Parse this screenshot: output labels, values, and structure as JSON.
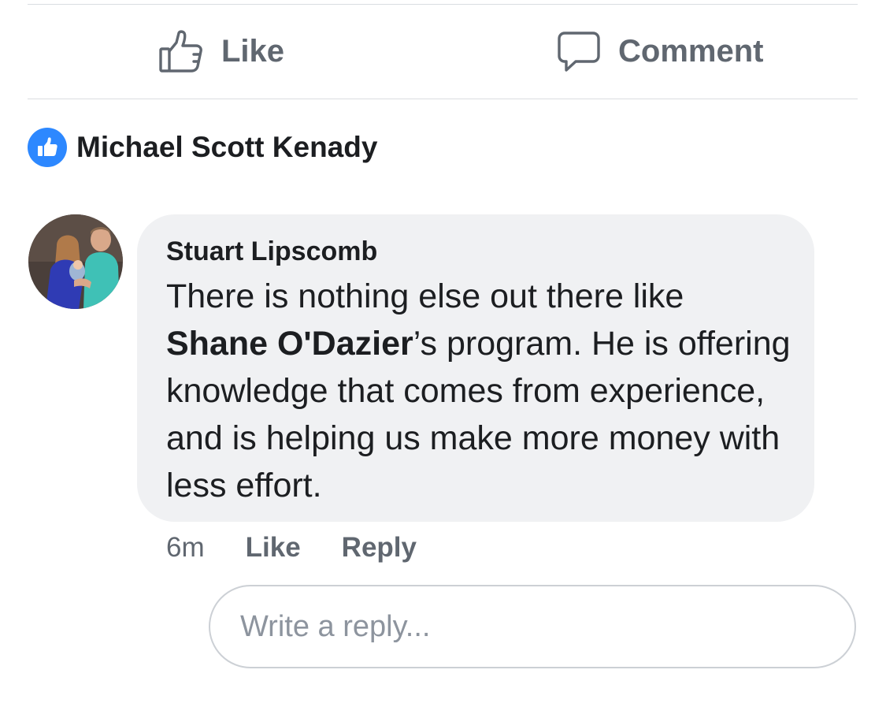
{
  "actions": {
    "like_label": "Like",
    "comment_label": "Comment"
  },
  "reactions": {
    "icon": "thumbs-up-badge-icon",
    "reactor_name": "Michael Scott Kenady"
  },
  "comment": {
    "author": "Stuart Lipscomb",
    "text_before": "There is nothing else out there like ",
    "mention": "Shane O'Dazier",
    "text_after": "’s program. He is offering knowledge that comes from experience, and is helping us make more money with less effort.",
    "time": "6m",
    "like_label": "Like",
    "reply_label": "Reply"
  },
  "reply": {
    "placeholder": "Write a reply..."
  },
  "colors": {
    "accent": "#2d88ff",
    "bubble": "#f0f1f3",
    "secondary_text": "#606770",
    "divider": "#dadde1"
  }
}
